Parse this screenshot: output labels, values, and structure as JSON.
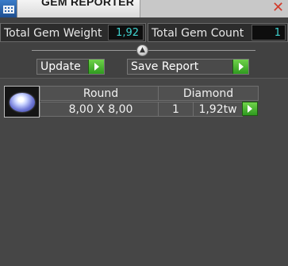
{
  "window": {
    "title": "GEM REPORTER",
    "close_glyph": "✕"
  },
  "totals": {
    "weight_label": "Total Gem Weight",
    "weight_value": "1,92",
    "count_label": "Total Gem Count",
    "count_value": "1"
  },
  "actions": {
    "update_label": "Update",
    "save_report_label": "Save Report"
  },
  "gems": [
    {
      "shape": "Round",
      "material": "Diamond",
      "size": "8,00 X 8,00",
      "count": "1",
      "weight": "1,92tw"
    }
  ],
  "icons": {
    "app": "gem-reporter-icon",
    "close": "close-icon",
    "divider_knob": "collapse-knob-icon",
    "play": "play-arrow-icon",
    "gem_thumbnail": "round-diamond-icon"
  },
  "colors": {
    "value_text": "#3fd3d0",
    "play_button": "#4fbf30",
    "close": "#d23a2a"
  }
}
